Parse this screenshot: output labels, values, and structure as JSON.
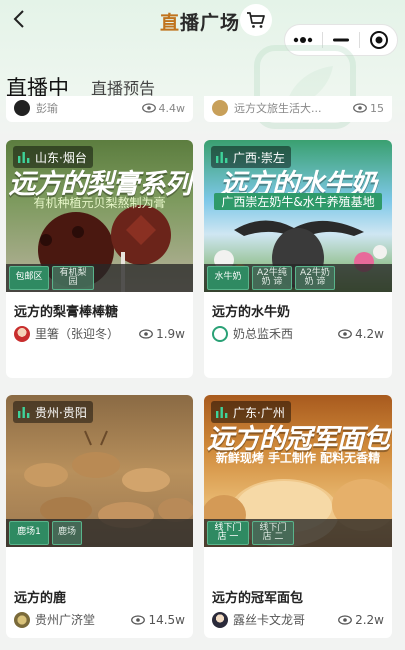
{
  "header": {
    "title_first": "直",
    "title_rest": "播广场",
    "back_icon": "chevron-left-icon",
    "cart_icon": "shopping-cart-icon"
  },
  "capsule": {
    "more_icon": "more-dots-icon",
    "minimize_icon": "minimize-icon",
    "close_icon": "close-circle-icon"
  },
  "tabs": [
    {
      "label": "直播中",
      "active": true
    },
    {
      "label": "直播预告",
      "active": false
    }
  ],
  "partial_cards": [
    {
      "author": "彭瑜",
      "views": "4.4w"
    },
    {
      "author": "远方文旅生活大...",
      "views": "15"
    }
  ],
  "cards": [
    {
      "location": "山东·烟台",
      "headline": "远方的梨膏系列",
      "subline": "有机种植元贝梨熬制为膏",
      "tags": [
        "包邮区",
        "有机梨园"
      ],
      "title": "远方的梨膏棒棒糖",
      "author": "里箸（张迎冬）",
      "views": "1.9w",
      "colors": {
        "bg1": "#6a8a4a",
        "bg2": "#b7b09a",
        "candy": "#5a1e14"
      }
    },
    {
      "location": "广西·崇左",
      "headline": "远方的水牛奶",
      "subline": "广西崇左奶牛&水牛养殖基地",
      "tags": [
        "水牛奶",
        "A2牛纯奶 谛",
        "A2牛奶奶 谛"
      ],
      "title": "远方的水牛奶",
      "author": "奶总监禾西",
      "views": "4.2w",
      "colors": {
        "bg1": "#2f9a6a",
        "bg2": "#8fbde0",
        "candy": "#2d2d2d"
      }
    },
    {
      "location": "贵州·贵阳",
      "headline": "",
      "subline": "",
      "tags": [
        "鹿场1",
        "鹿场"
      ],
      "title": "远方的鹿",
      "author": "贵州广济堂",
      "views": "14.5w",
      "colors": {
        "bg1": "#a07a4c",
        "bg2": "#c9a36c",
        "candy": "#7a5a36"
      }
    },
    {
      "location": "广东·广州",
      "headline": "远方的冠军面包",
      "subline": "新鲜现烤 手工制作 配料无香精",
      "tags": [
        "线下门店 一",
        "线下门店 二"
      ],
      "title": "远方的冠军面包",
      "author": "露丝卡文龙哥",
      "views": "2.2w",
      "colors": {
        "bg1": "#b86a2a",
        "bg2": "#e6b46c",
        "candy": "#d98c3a"
      }
    }
  ],
  "accent_color": "#2aa176"
}
